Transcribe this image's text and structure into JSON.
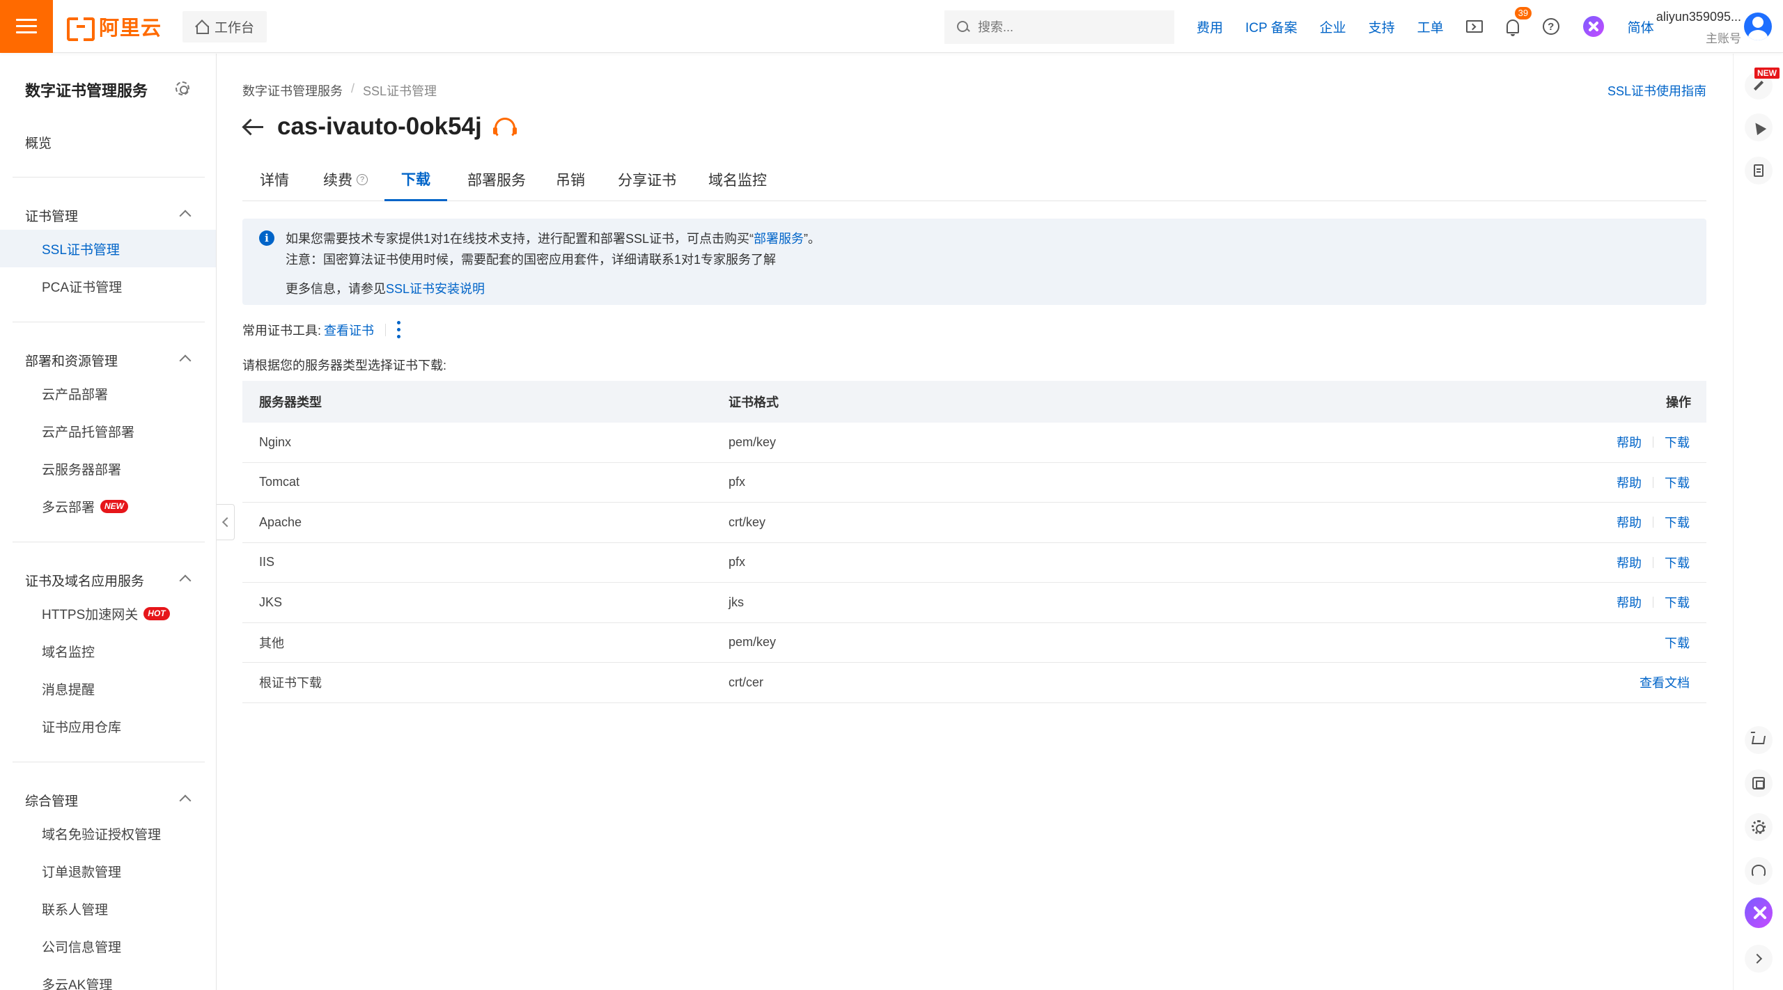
{
  "topbar": {
    "logo_text": "阿里云",
    "workbench_label": "工作台",
    "search_placeholder": "搜索...",
    "nav_links": [
      "费用",
      "ICP 备案",
      "企业",
      "支持",
      "工单"
    ],
    "notification_count": "39",
    "language": "简体",
    "account_name": "aliyun359095...",
    "account_role": "主账号",
    "colors": {
      "brand": "#ff6a00",
      "accent": "#0064c8"
    }
  },
  "sidebar": {
    "title": "数字证书管理服务",
    "overview": "概览",
    "groups": [
      {
        "label": "证书管理",
        "items": [
          {
            "label": "SSL证书管理",
            "active": true
          },
          {
            "label": "PCA证书管理"
          }
        ]
      },
      {
        "label": "部署和资源管理",
        "items": [
          {
            "label": "云产品部署"
          },
          {
            "label": "云产品托管部署"
          },
          {
            "label": "云服务器部署"
          },
          {
            "label": "多云部署",
            "tag": "NEW"
          }
        ]
      },
      {
        "label": "证书及域名应用服务",
        "items": [
          {
            "label": "HTTPS加速网关",
            "tag": "HOT"
          },
          {
            "label": "域名监控"
          },
          {
            "label": "消息提醒"
          },
          {
            "label": "证书应用仓库"
          }
        ]
      },
      {
        "label": "综合管理",
        "items": [
          {
            "label": "域名免验证授权管理"
          },
          {
            "label": "订单退款管理"
          },
          {
            "label": "联系人管理"
          },
          {
            "label": "公司信息管理"
          },
          {
            "label": "多云AK管理"
          }
        ]
      }
    ]
  },
  "main": {
    "breadcrumb": [
      "数字证书管理服务",
      "SSL证书管理"
    ],
    "guide_link": "SSL证书使用指南",
    "title": "cas-ivauto-0ok54j",
    "tabs": [
      {
        "label": "详情"
      },
      {
        "label": "续费",
        "help": "?"
      },
      {
        "label": "下载",
        "active": true
      },
      {
        "label": "部署服务"
      },
      {
        "label": "吊销"
      },
      {
        "label": "分享证书"
      },
      {
        "label": "域名监控"
      }
    ],
    "notice": {
      "line1_prefix": "如果您需要技术专家提供1对1在线技术支持，进行配置和部署SSL证书，可点击购买“",
      "line1_link": "部署服务",
      "line1_suffix": "”。",
      "line2": "注意：国密算法证书使用时候，需要配套的国密应用套件，详细请联系1对1专家服务了解",
      "line3_prefix": "更多信息，请参见",
      "line3_link": "SSL证书安装说明"
    },
    "tools_label": "常用证书工具:",
    "tools_link": "查看证书",
    "hint": "请根据您的服务器类型选择证书下载:",
    "table": {
      "headers": [
        "服务器类型",
        "证书格式",
        "操作"
      ],
      "rows": [
        {
          "server": "Nginx",
          "format": "pem/key",
          "help": "帮助",
          "action": "下载"
        },
        {
          "server": "Tomcat",
          "format": "pfx",
          "help": "帮助",
          "action": "下载"
        },
        {
          "server": "Apache",
          "format": "crt/key",
          "help": "帮助",
          "action": "下载"
        },
        {
          "server": "IIS",
          "format": "pfx",
          "help": "帮助",
          "action": "下载"
        },
        {
          "server": "JKS",
          "format": "jks",
          "help": "帮助",
          "action": "下载"
        },
        {
          "server": "其他",
          "format": "pem/key",
          "help": "",
          "action": "下载"
        },
        {
          "server": "根证书下载",
          "format": "crt/cer",
          "help": "",
          "action": "查看文档"
        }
      ]
    }
  },
  "rail": {
    "new_badge": "NEW"
  }
}
